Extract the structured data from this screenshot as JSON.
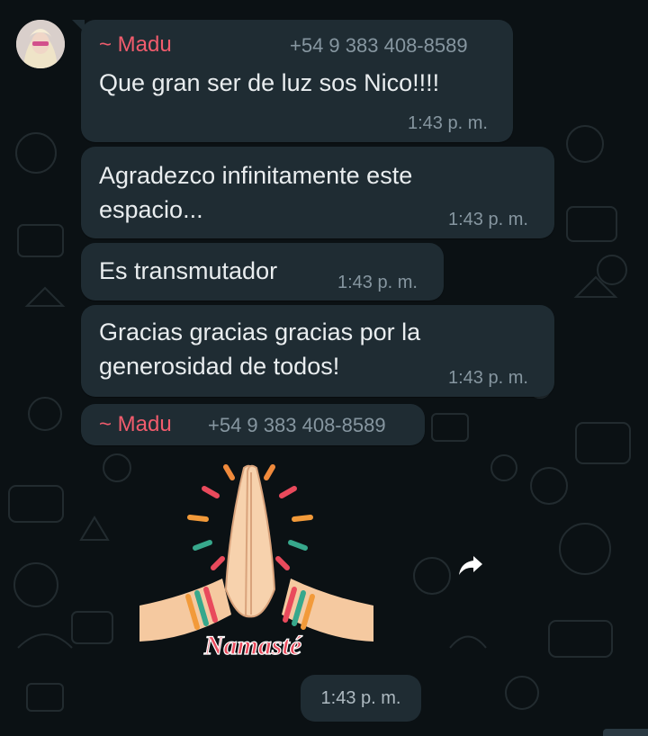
{
  "chat": {
    "messages": [
      {
        "sender": "~ Madu",
        "phone": "+54 9 383 408-8589",
        "lines": [
          "Que gran ser de luz sos Nico!!!!"
        ],
        "time": "1:43 p. m."
      },
      {
        "lines": [
          "Agradezco infinitamente este",
          "espacio..."
        ],
        "time": "1:43 p. m."
      },
      {
        "lines": [
          "Es transmutador"
        ],
        "time": "1:43 p. m."
      },
      {
        "lines": [
          "Gracias gracias gracias por la",
          "generosidad de todos!"
        ],
        "time": "1:43 p. m."
      }
    ],
    "sticker_message": {
      "sender": "~ Madu",
      "phone": "+54 9 383 408-8589",
      "sticker_text": "Namasté",
      "sticker_icon": "praying-hands",
      "time": "1:43 p. m."
    },
    "forward_icon": "forward-arrow-icon",
    "colors": {
      "background": "#0b1114",
      "bubble": "#1f2c33",
      "sender_name": "#f15c6d",
      "meta_text": "#8696a0"
    }
  }
}
